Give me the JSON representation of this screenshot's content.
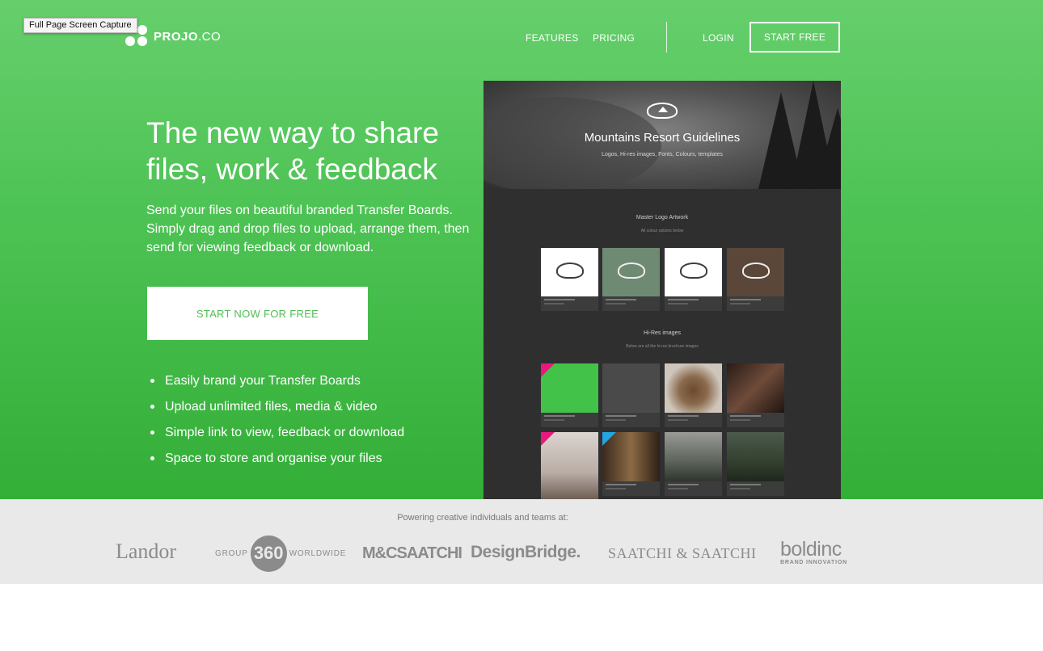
{
  "capture_tooltip": "Full Page Screen Capture",
  "brand": {
    "name_bold": "PROJO",
    "name_rest": ".CO"
  },
  "nav": {
    "features": "FEATURES",
    "pricing": "PRICING",
    "login": "LOGIN",
    "start_free": "START FREE"
  },
  "hero": {
    "headline": "The new way to share files, work & feedback",
    "subcopy": "Send your files on beautiful branded Transfer Boards. Simply drag and drop files to upload, arrange them, then send for viewing feedback or download.",
    "cta": "START NOW FOR FREE",
    "bullets": [
      "Easily brand your Transfer Boards",
      "Upload unlimited files, media & video",
      "Simple link to view, feedback or download",
      "Space to store and organise your files"
    ]
  },
  "mockup": {
    "title": "Mountains Resort Guidelines",
    "tagline": "Logos, Hi-res images, Fonts, Colours, templates",
    "section1_title": "Master Logo Artwork",
    "section1_sub": "All colour options below",
    "section2_title": "Hi-Res images",
    "section2_sub": "Below are all the hi-res brochure images"
  },
  "clients": {
    "caption": "Powering creative individuals and teams at:",
    "landor": "Landor",
    "group360_left": "GROUP",
    "group360_mid": "360",
    "group360_right": "WORLDWIDE",
    "mcsaatchi": "M&CSAATCHI",
    "designbridge": "DesignBridge.",
    "saatchi": "SAATCHI & SAATCHI",
    "boldinc": "boldinc",
    "boldinc_tag": "BRAND INNOVATION"
  },
  "colors": {
    "hero_top": "#66cf6c",
    "hero_bottom": "#33ae37",
    "cta_text": "#4cbf52",
    "band_bg": "#e9e9e9"
  }
}
